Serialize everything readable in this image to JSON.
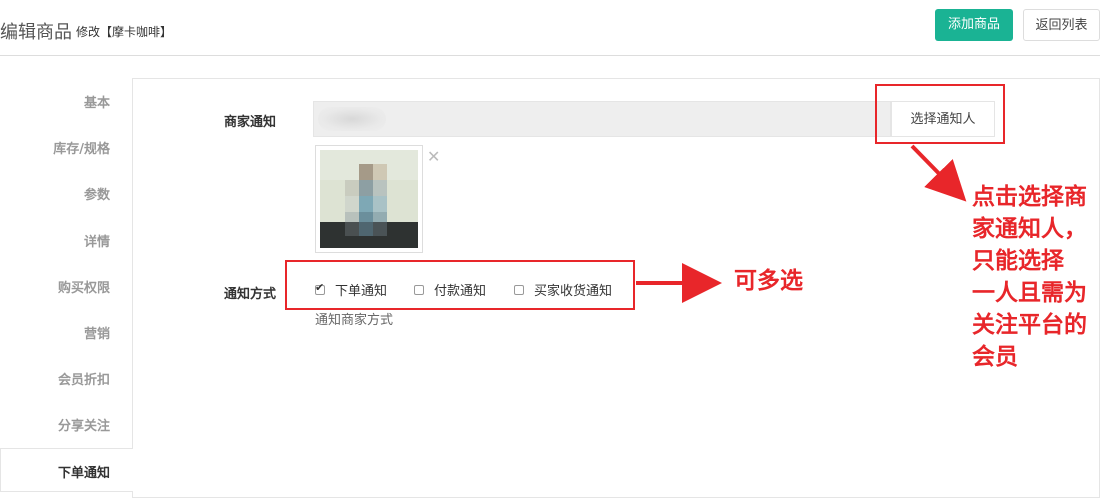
{
  "header": {
    "title": "编辑商品",
    "subtitle": "修改【摩卡咖啡】",
    "add_button": "添加商品",
    "back_button": "返回列表",
    "accent_color": "#1ab394"
  },
  "sidebar": {
    "items": [
      {
        "label": "基本"
      },
      {
        "label": "库存/规格"
      },
      {
        "label": "参数"
      },
      {
        "label": "详情"
      },
      {
        "label": "购买权限"
      },
      {
        "label": "营销"
      },
      {
        "label": "会员折扣"
      },
      {
        "label": "分享关注"
      },
      {
        "label": "下单通知",
        "active": true
      }
    ]
  },
  "form": {
    "merchant_notify_label": "商家通知",
    "select_notifier_button": "选择通知人",
    "remove_icon": "close-icon",
    "notify_method_label": "通知方式",
    "options": [
      {
        "label": "下单通知",
        "checked": true
      },
      {
        "label": "付款通知",
        "checked": false
      },
      {
        "label": "买家收货通知",
        "checked": false
      }
    ],
    "hint": "通知商家方式"
  },
  "annotations": {
    "multi_select": "可多选",
    "select_note": [
      "点击选择商",
      "家通知人，",
      "只能选择",
      "一人且需为",
      "关注平台的",
      "会员"
    ],
    "color": "#e8262a"
  }
}
